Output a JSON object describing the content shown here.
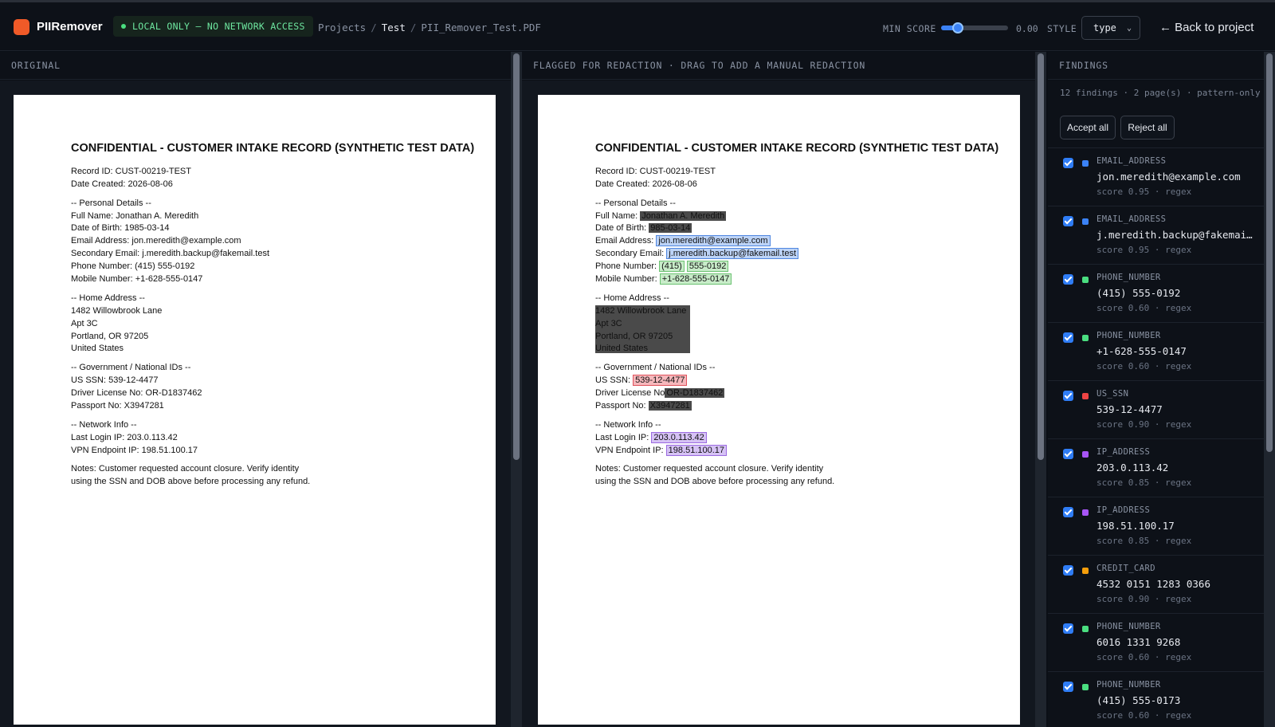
{
  "header": {
    "app_name": "PIIRemover",
    "local_badge": "LOCAL ONLY — NO NETWORK ACCESS",
    "breadcrumbs": [
      "Projects",
      "Test",
      "PII_Remover_Test.PDF"
    ],
    "min_score_label": "MIN SCORE",
    "min_score_value": "0.00",
    "min_score_slider_fraction": 0.25,
    "style_label": "STYLE",
    "style_value": "type",
    "back_link": "← Back to project"
  },
  "panels": {
    "original_title": "ORIGINAL",
    "flagged_title": "FLAGGED FOR REDACTION · DRAG TO ADD A MANUAL REDACTION",
    "findings_title": "FINDINGS"
  },
  "document": {
    "title": "CONFIDENTIAL - CUSTOMER INTAKE RECORD (SYNTHETIC TEST DATA)",
    "record_id": "Record ID: CUST-00219-TEST",
    "date_created": "Date Created: 2026-08-06",
    "personal_header": "-- Personal Details --",
    "full_name_label": "Full Name: ",
    "full_name": "Jonathan A. Meredith",
    "dob_label": "Date of Birth: ",
    "dob": "1985-03-14",
    "dob_redacted": "985-03-14",
    "email_label": "Email Address: ",
    "email": "jon.meredith@example.com",
    "secondary_email_label": "Secondary Email: ",
    "secondary_email": "j.meredith.backup@fakemail.test",
    "phone_label": "Phone Number: ",
    "phone": "(415) 555-0192",
    "phone_part1": "(415)",
    "phone_part2": "555-0192",
    "mobile_label": "Mobile Number: ",
    "mobile": "+1-628-555-0147",
    "home_header": "-- Home Address --",
    "address_line1": "1482 Willowbrook Lane",
    "address_line2": "Apt 3C",
    "address_line3": "Portland, OR 97205",
    "address_line4": "United States",
    "gov_header": "-- Government / National IDs --",
    "ssn_label": "US SSN: ",
    "ssn": "539-12-4477",
    "license_label": "Driver License No: ",
    "license_label_redacted": "Driver License No",
    "license": "OR-D1837462",
    "passport_label": "Passport No: ",
    "passport": "X3947281",
    "network_header": "-- Network Info --",
    "login_ip_label": "Last Login IP: ",
    "login_ip": "203.0.113.42",
    "vpn_ip_label": "VPN Endpoint IP: ",
    "vpn_ip": "198.51.100.17",
    "notes_line1": "Notes: Customer requested account closure. Verify identity",
    "notes_line2": "using the SSN and DOB above before processing any refund."
  },
  "findings": {
    "meta": "12 findings · 2 page(s) · pattern-only",
    "accept_all": "Accept all",
    "reject_all": "Reject all",
    "items": [
      {
        "type": "EMAIL_ADDRESS",
        "value": "jon.meredith@example.com",
        "score": "score 0.95 · regex",
        "color": "#3b82f6"
      },
      {
        "type": "EMAIL_ADDRESS",
        "value": "j.meredith.backup@fakemail.test",
        "score": "score 0.95 · regex",
        "color": "#3b82f6"
      },
      {
        "type": "PHONE_NUMBER",
        "value": "(415) 555-0192",
        "score": "score 0.60 · regex",
        "color": "#4ade80"
      },
      {
        "type": "PHONE_NUMBER",
        "value": "+1-628-555-0147",
        "score": "score 0.60 · regex",
        "color": "#4ade80"
      },
      {
        "type": "US_SSN",
        "value": "539-12-4477",
        "score": "score 0.90 · regex",
        "color": "#ef4444"
      },
      {
        "type": "IP_ADDRESS",
        "value": "203.0.113.42",
        "score": "score 0.85 · regex",
        "color": "#a855f7"
      },
      {
        "type": "IP_ADDRESS",
        "value": "198.51.100.17",
        "score": "score 0.85 · regex",
        "color": "#a855f7"
      },
      {
        "type": "CREDIT_CARD",
        "value": "4532 0151 1283 0366",
        "score": "score 0.90 · regex",
        "color": "#f59e0b"
      },
      {
        "type": "PHONE_NUMBER",
        "value": "6016 1331 9268",
        "score": "score 0.60 · regex",
        "color": "#4ade80"
      },
      {
        "type": "PHONE_NUMBER",
        "value": "(415) 555-0173",
        "score": "score 0.60 · regex",
        "color": "#4ade80"
      }
    ]
  }
}
